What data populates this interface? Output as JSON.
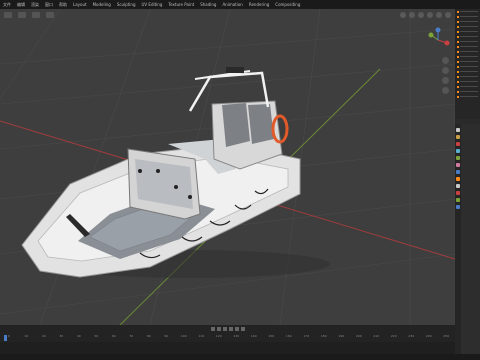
{
  "app": {
    "name": "Blender"
  },
  "menu": [
    "文件",
    "编辑",
    "渲染",
    "窗口",
    "帮助",
    "Layout",
    "Modeling",
    "Sculpting",
    "UV Editing",
    "Texture Paint",
    "Shading",
    "Animation",
    "Rendering",
    "Compositing"
  ],
  "viewport": {
    "axis_colors": {
      "x": "#c84040",
      "y": "#7ca33a",
      "z": "#4a7cc8"
    },
    "grid_color": "#4a4a4a",
    "background": "#3e3e3e",
    "object": "inflatable rescue boat"
  },
  "timeline": {
    "frames": [
      "0",
      "10",
      "20",
      "30",
      "40",
      "50",
      "60",
      "70",
      "80",
      "90",
      "100",
      "110",
      "120",
      "130",
      "140",
      "150",
      "160",
      "170",
      "180",
      "190",
      "200",
      "210",
      "220",
      "230",
      "240",
      "250"
    ],
    "accent": "#4a7cc8"
  },
  "properties": {
    "tab_colors": [
      "#c8c8c8",
      "#c8a04a",
      "#c84040",
      "#5ab0d0",
      "#7ca33a",
      "#d07aa0",
      "#4a7cc8",
      "#ff8c1a",
      "#c8c8c8",
      "#c84040",
      "#7ca33a",
      "#4a7cc8"
    ],
    "rows": [
      "",
      "",
      "",
      "",
      "",
      "",
      "",
      "",
      "",
      "",
      "",
      "",
      "",
      "",
      "",
      "",
      "",
      "",
      "",
      ""
    ]
  }
}
